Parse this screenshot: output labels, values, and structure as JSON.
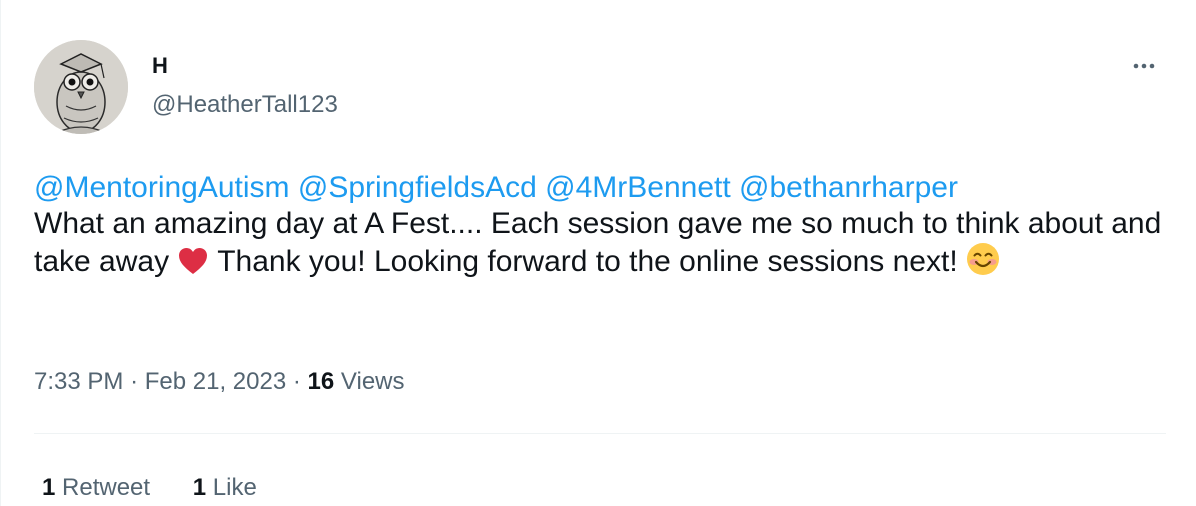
{
  "author": {
    "display_name": "H",
    "handle": "@HeatherTall123"
  },
  "tweet": {
    "mentions": [
      "@MentoringAutism",
      "@SpringfieldsAcd",
      "@4MrBennett",
      "@bethanrharper"
    ],
    "text_part1": "What an amazing day at A Fest.... Each session gave me so much to think about and take away",
    "emoji_heart": "red-heart-emoji",
    "text_part2": "Thank you! Looking forward to the online sessions next!",
    "emoji_smile": "smiling-face-emoji"
  },
  "meta": {
    "time": "7:33 PM",
    "separator": "·",
    "date": "Feb 21, 2023",
    "views_count": "16",
    "views_label": "Views"
  },
  "stats": {
    "retweets_count": "1",
    "retweets_label": "Retweet",
    "likes_count": "1",
    "likes_label": "Like"
  },
  "icons": {
    "more": "more-options-icon"
  },
  "colors": {
    "link": "#1d9bf0",
    "secondary_text": "#536471",
    "primary_text": "#0f1419",
    "divider": "#eff3f4"
  }
}
